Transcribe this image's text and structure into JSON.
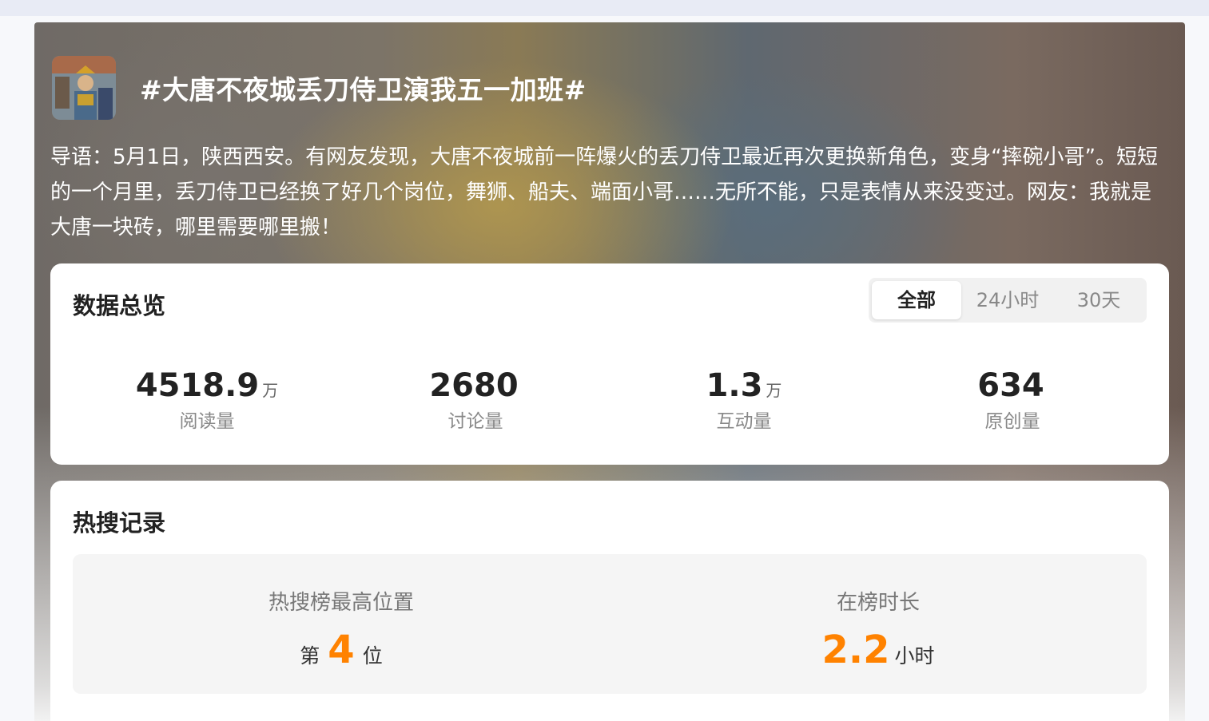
{
  "topic": {
    "title": "#大唐不夜城丢刀侍卫演我五一加班#",
    "intro": "导语：5月1日，陕西西安。有网友发现，大唐不夜城前一阵爆火的丢刀侍卫最近再次更换新角色，变身“摔碗小哥”。短短的一个月里，丢刀侍卫已经换了好几个岗位，舞狮、船夫、端面小哥……无所不能，只是表情从来没变过。网友：我就是大唐一块砖，哪里需要哪里搬！"
  },
  "overview": {
    "title": "数据总览",
    "tabs": [
      {
        "label": "全部",
        "active": true
      },
      {
        "label": "24小时",
        "active": false
      },
      {
        "label": "30天",
        "active": false
      }
    ],
    "stats": [
      {
        "value": "4518.9",
        "unit": "万",
        "label": "阅读量"
      },
      {
        "value": "2680",
        "unit": "",
        "label": "讨论量"
      },
      {
        "value": "1.3",
        "unit": "万",
        "label": "互动量"
      },
      {
        "value": "634",
        "unit": "",
        "label": "原创量"
      }
    ]
  },
  "hot_search": {
    "title": "热搜记录",
    "highest_rank": {
      "label": "热搜榜最高位置",
      "prefix": "第",
      "value": "4",
      "suffix": "位"
    },
    "duration": {
      "label": "在榜时长",
      "value": "2.2",
      "suffix": "小时"
    }
  },
  "colors": {
    "accent": "#ff8200",
    "text": "#222222",
    "muted": "#888888"
  }
}
